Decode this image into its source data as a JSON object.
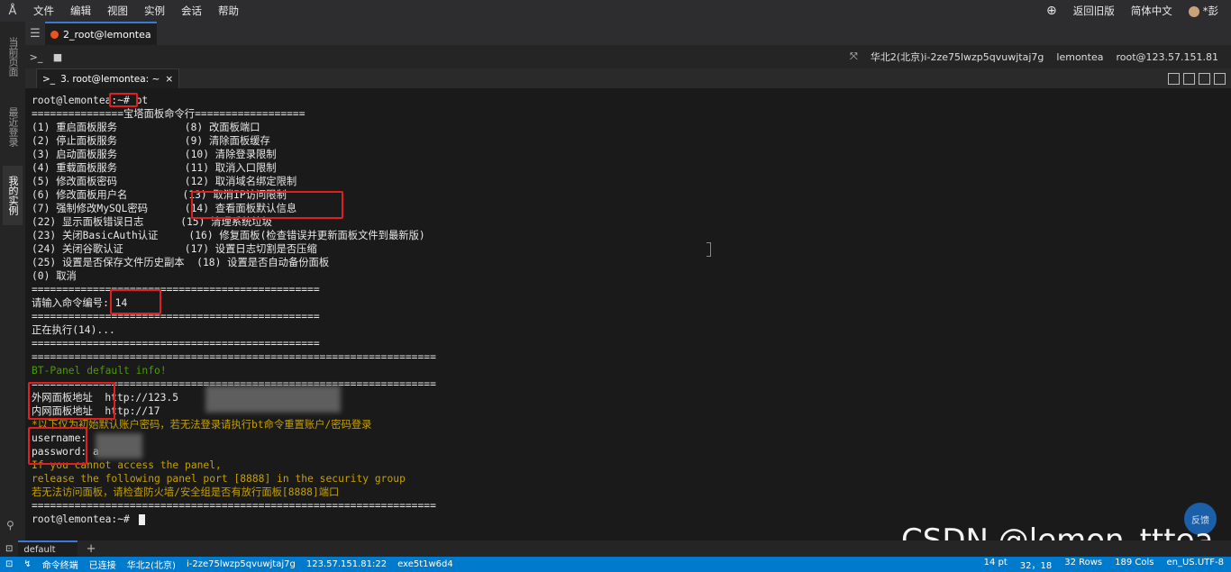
{
  "menu": {
    "logo": "Å",
    "items": [
      "文件",
      "编辑",
      "视图",
      "实例",
      "会话",
      "帮助"
    ],
    "right": {
      "restore": "返回旧版",
      "language": "简体中文",
      "user": "*彭"
    }
  },
  "leftbar": {
    "tabs": [
      "当前页面",
      "最近登录",
      "我的实例"
    ]
  },
  "session_tab": {
    "label": "2_root@lemontea"
  },
  "infobar": {
    "region": "华北2(北京)",
    "instance": "i-2ze75lwzp5qvuwjtaj7g",
    "host": "lemontea",
    "login": "root@123.57.151.81"
  },
  "terminal_tab": {
    "label": "3. root@lemontea: ~"
  },
  "terminal": {
    "lines": [
      "root@lemontea:~# bt",
      "===============宝塔面板命令行==================",
      "(1) 重启面板服务           (8) 改面板端口",
      "(2) 停止面板服务           (9) 清除面板缓存",
      "(3) 启动面板服务           (10) 清除登录限制",
      "(4) 重载面板服务           (11) 取消入口限制",
      "(5) 修改面板密码           (12) 取消域名绑定限制",
      "(6) 修改面板用户名         (13) 取消IP访问限制",
      "(7) 强制修改MySQL密码      (14) 查看面板默认信息",
      "(22) 显示面板错误日志      (15) 清理系统垃圾",
      "(23) 关闭BasicAuth认证     (16) 修复面板(检查错误并更新面板文件到最新版)",
      "(24) 关闭谷歌认证          (17) 设置日志切割是否压缩",
      "(25) 设置是否保存文件历史副本  (18) 设置是否自动备份面板",
      "(0) 取消",
      "===============================================",
      "请输入命令编号: 14",
      "===============================================",
      "正在执行(14)...",
      "===============================================",
      "==================================================================",
      "BT-Panel default info!",
      "==================================================================",
      "外网面板地址  http://123.5",
      "内网面板地址  http://17",
      "*以下仅为初始默认账户密码，若无法登录请执行bt命令重置账户/密码登录",
      "username: ",
      "password: a",
      "If you cannot access the panel,",
      "release the following panel port [8888] in the security group",
      "若无法访问面板，请检查防火墙/安全组是否有放行面板[8888]端口",
      "==================================================================",
      "root@lemontea:~# "
    ]
  },
  "feedback": "反馈",
  "watermark": "CSDN @lemon_tttea",
  "bottom_tab": {
    "label": "default"
  },
  "status": {
    "items": [
      "命令终端",
      "已连接",
      "华北2(北京)",
      "i-2ze75lwzp5qvuwjtaj7g",
      "123.57.151.81:22",
      "exe5t1w6d4"
    ],
    "right": [
      "14 pt",
      "32，18",
      "32 Rows",
      "189 Cols",
      "en_US.UTF-8"
    ]
  },
  "colors": {
    "accent": "#007acc",
    "highlight_box": "#e02020",
    "green_text": "#4e9a06",
    "yellow_text": "#c4a000"
  }
}
